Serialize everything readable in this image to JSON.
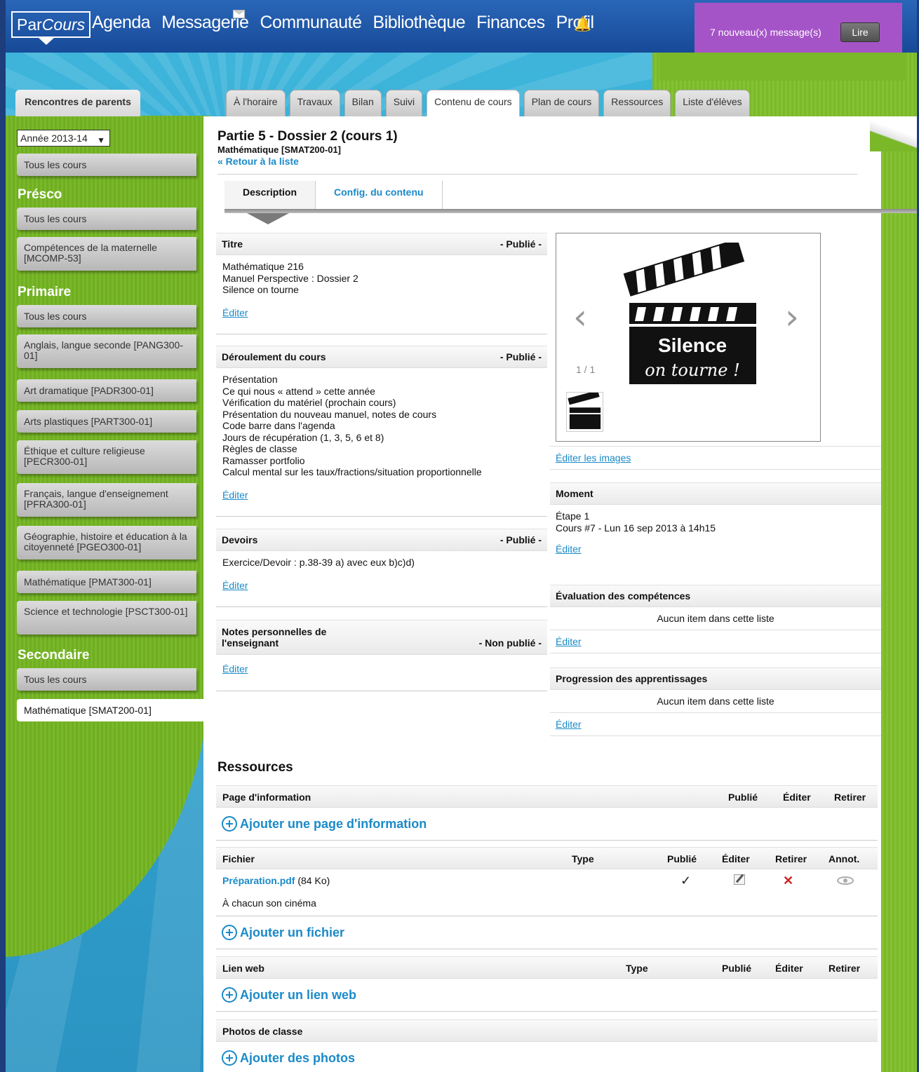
{
  "header": {
    "logo_par": "Par",
    "logo_cours": "Cours",
    "nav": [
      "Agenda",
      "Messagerie",
      "Communauté",
      "Bibliothèque",
      "Finances",
      "Profil"
    ],
    "messages_text": "7 nouveau(x) message(s)",
    "read_button": "Lire"
  },
  "parents_tab": "Rencontres de parents",
  "tabs": [
    "À l'horaire",
    "Travaux",
    "Bilan",
    "Suivi",
    "Contenu de cours",
    "Plan de cours",
    "Ressources",
    "Liste d'élèves"
  ],
  "active_tab": "Contenu de cours",
  "sidebar": {
    "year": "Année 2013-14",
    "top_all": "Tous les cours",
    "presco": {
      "heading": "Présco",
      "items": [
        "Tous les cours",
        "Compétences de la maternelle [MCOMP-53]"
      ]
    },
    "primaire": {
      "heading": "Primaire",
      "items": [
        "Tous les cours",
        "Anglais, langue seconde [PANG300-01]",
        "Art dramatique [PADR300-01]",
        "Arts plastiques [PART300-01]",
        "Éthique et culture religieuse [PECR300-01]",
        "Français, langue d'enseignement [PFRA300-01]",
        "Géographie, histoire et éducation à la citoyenneté [PGEO300-01]",
        "Mathématique [PMAT300-01]",
        "Science et technologie [PSCT300-01]"
      ]
    },
    "secondaire": {
      "heading": "Secondaire",
      "items": [
        "Tous les cours",
        "Mathématique [SMAT200-01]"
      ]
    }
  },
  "page": {
    "title": "Partie 5 - Dossier 2 (cours 1)",
    "subtitle": "Mathématique [SMAT200-01]",
    "back": "« Retour à la liste",
    "subtabs": [
      "Description",
      "Config. du contenu"
    ]
  },
  "sections": {
    "titre": {
      "title": "Titre",
      "status": "- Publié -",
      "lines": [
        "Mathématique 216",
        "Manuel Perspective : Dossier 2",
        "Silence on tourne"
      ],
      "edit": "Éditer"
    },
    "deroulement": {
      "title": "Déroulement du cours",
      "status": "- Publié -",
      "lines": [
        "Présentation",
        "Ce qui nous « attend » cette année",
        "Vérification du matériel (prochain cours)",
        "Présentation du nouveau manuel, notes de cours",
        "Code barre dans l'agenda",
        "Jours de récupération (1, 3, 5, 6 et 8)",
        "Règles de classe",
        "Ramasser portfolio",
        "Calcul mental sur les taux/fractions/situation proportionnelle"
      ],
      "edit": "Éditer"
    },
    "devoirs": {
      "title": "Devoirs",
      "status": "- Publié -",
      "lines": [
        "Exercice/Devoir : p.38-39 a) avec eux b)c)d)"
      ],
      "edit": "Éditer"
    },
    "notes": {
      "title_line1": "Notes personnelles de",
      "title_line2": "l'enseignant",
      "status": "- Non publié -",
      "edit": "Éditer"
    }
  },
  "gallery": {
    "counter": "1 / 1",
    "image_text_1": "Silence",
    "image_text_2": "on tourne !",
    "edit_images": "Éditer les images"
  },
  "moment": {
    "title": "Moment",
    "line1": "Étape 1",
    "line2": "Cours #7 - Lun 16 sep 2013 à 14h15",
    "edit": "Éditer"
  },
  "evaluation": {
    "title": "Évaluation des compétences",
    "empty": "Aucun item dans cette liste",
    "edit": "Éditer"
  },
  "progression": {
    "title": "Progression des apprentissages",
    "empty": "Aucun item dans cette liste",
    "edit": "Éditer"
  },
  "resources": {
    "title": "Ressources",
    "info_page": {
      "col_name": "Page d'information",
      "col_publie": "Publié",
      "col_editer": "Éditer",
      "col_retirer": "Retirer",
      "add": "Ajouter une page d'information"
    },
    "file": {
      "col_name": "Fichier",
      "col_type": "Type",
      "col_publie": "Publié",
      "col_editer": "Éditer",
      "col_retirer": "Retirer",
      "col_annot": "Annot.",
      "file_name": "Préparation.pdf",
      "file_size": "(84 Ko)",
      "file_desc": "À chacun son cinéma",
      "check": "✓",
      "retire": "✕",
      "add": "Ajouter un fichier"
    },
    "web": {
      "col_name": "Lien web",
      "col_type": "Type",
      "col_publie": "Publié",
      "col_editer": "Éditer",
      "col_retirer": "Retirer",
      "add": "Ajouter un lien web"
    },
    "photos": {
      "col_name": "Photos de classe",
      "add": "Ajouter des photos"
    }
  }
}
